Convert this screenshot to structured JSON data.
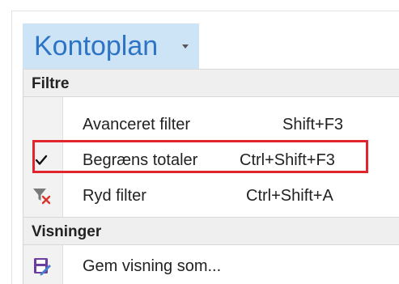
{
  "tab": {
    "label": "Kontoplan"
  },
  "menu": {
    "sections": [
      {
        "header": "Filtre",
        "items": [
          {
            "label": "Avanceret filter",
            "shortcut": "Shift+F3",
            "icon": ""
          },
          {
            "label": "Begræns totaler",
            "shortcut": "Ctrl+Shift+F3",
            "icon": "checkmark-icon"
          },
          {
            "label": "Ryd filter",
            "shortcut": "Ctrl+Shift+A",
            "icon": "clear-filter-icon"
          }
        ]
      },
      {
        "header": "Visninger",
        "items": [
          {
            "label": "Gem visning som...",
            "shortcut": "",
            "icon": "save-view-icon"
          }
        ]
      }
    ]
  },
  "colors": {
    "tab_background": "#cde3f6",
    "tab_text": "#2e74c4",
    "highlight_border": "#e0252f",
    "clear_filter_x": "#d9342b",
    "save_view_icon": "#6b3fa0"
  }
}
